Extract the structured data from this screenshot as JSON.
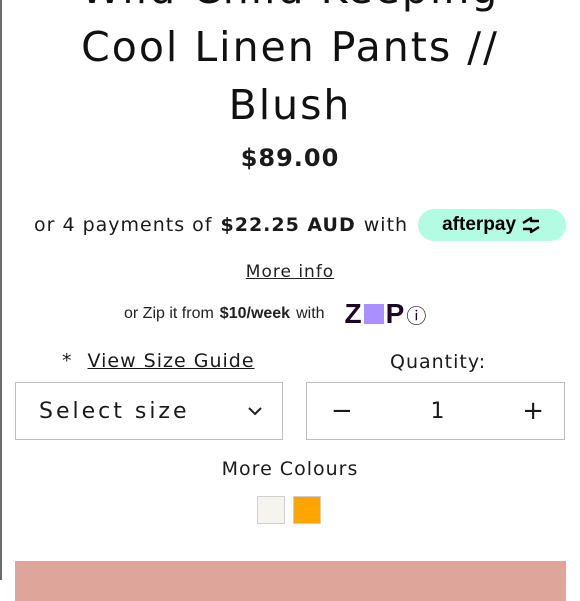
{
  "product": {
    "title_line1": "Wild Child Keeping",
    "title_line2": "Cool Linen Pants //",
    "title_line3": "Blush",
    "price": "$89.00"
  },
  "afterpay": {
    "prefix": "or 4 payments of",
    "amount": "$22.25 AUD",
    "suffix": "with",
    "badge_text": "afterpay",
    "badge_color": "#b2fce4"
  },
  "more_info": "More info",
  "zip": {
    "prefix": "or Zip it from",
    "amount": "$10/week",
    "suffix": "with",
    "logo_left": "Z",
    "logo_right": "P",
    "info_icon": "ⓘ",
    "accent_color": "#aa8fff"
  },
  "size_guide": {
    "marker": "*",
    "label": "View Size Guide"
  },
  "size_select": {
    "value": "Select size",
    "icon": "chevron-down-icon"
  },
  "quantity": {
    "label": "Quantity:",
    "value": "1",
    "minus": "−",
    "plus": "+"
  },
  "colours": {
    "label": "More Colours",
    "swatches": [
      {
        "name": "cream",
        "color": "#f6f4ee"
      },
      {
        "name": "orange",
        "color": "#ffa500"
      }
    ]
  },
  "cta": {
    "color": "#dea59b"
  }
}
